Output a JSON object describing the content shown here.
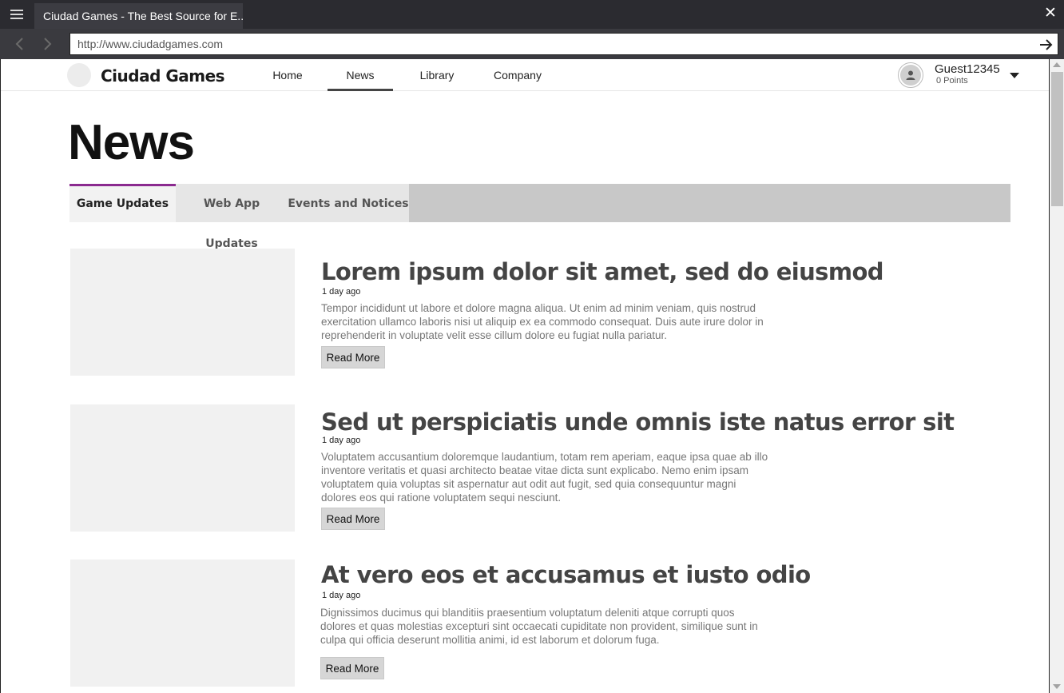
{
  "browser": {
    "tab_title": "Ciudad Games - The Best Source for E...",
    "url": "http://www.ciudadgames.com",
    "close_label": "✕"
  },
  "header": {
    "brand": "Ciudad Games",
    "nav": [
      {
        "label": "Home",
        "active": false
      },
      {
        "label": "News",
        "active": true
      },
      {
        "label": "Library",
        "active": false
      },
      {
        "label": "Company",
        "active": false
      }
    ],
    "user": {
      "name": "Guest12345",
      "points": "0 Points"
    }
  },
  "page": {
    "title": "News",
    "tabs": [
      {
        "label": "Game Updates",
        "active": true
      },
      {
        "label": "Web App Updates",
        "active": false
      },
      {
        "label": "Events and Notices",
        "active": false
      }
    ],
    "accent_color": "#8b2a8f"
  },
  "articles": [
    {
      "title": "Lorem ipsum dolor sit amet, sed do eiusmod",
      "date": "1 day ago",
      "body": "Tempor incididunt ut labore et dolore magna aliqua. Ut enim ad minim veniam, quis nostrud exercitation ullamco laboris nisi ut aliquip ex ea commodo consequat. Duis aute irure dolor in reprehenderit in voluptate velit esse cillum dolore eu fugiat nulla pariatur.",
      "button": "Read More"
    },
    {
      "title": "Sed ut perspiciatis unde omnis iste natus error sit",
      "date": "1 day ago",
      "body": "Voluptatem accusantium doloremque laudantium, totam rem aperiam, eaque ipsa quae ab illo inventore veritatis et quasi architecto beatae vitae dicta sunt explicabo. Nemo enim ipsam voluptatem quia voluptas sit aspernatur aut odit aut fugit, sed quia consequuntur magni dolores eos qui ratione voluptatem sequi nesciunt.",
      "button": "Read More"
    },
    {
      "title": "At vero eos et accusamus et iusto odio",
      "date": "1 day ago",
      "body": "Dignissimos ducimus qui blanditiis praesentium voluptatum deleniti atque corrupti quos dolores et quas molestias excepturi sint occaecati cupiditate non provident, similique sunt in culpa qui officia deserunt mollitia animi, id est laborum et dolorum fuga.",
      "button": "Read More"
    }
  ]
}
